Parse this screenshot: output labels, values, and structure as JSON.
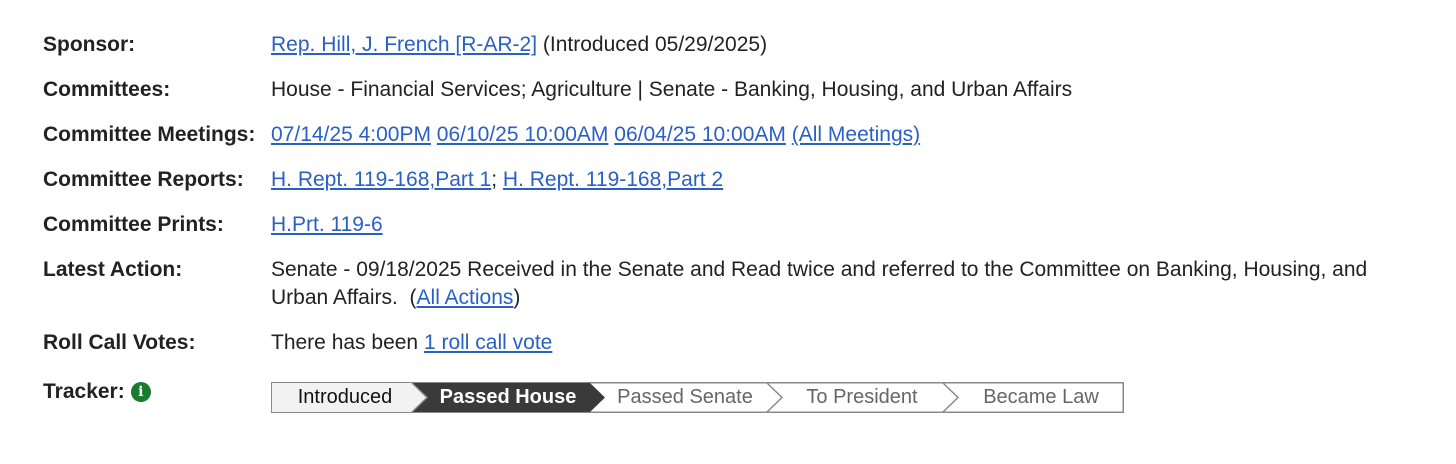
{
  "sponsor": {
    "label": "Sponsor:",
    "link": "Rep. Hill, J. French [R-AR-2]",
    "introduced": "(Introduced 05/29/2025)"
  },
  "committees": {
    "label": "Committees:",
    "text": "House - Financial Services; Agriculture | Senate - Banking, Housing, and Urban Affairs"
  },
  "meetings": {
    "label": "Committee Meetings:",
    "items": [
      "07/14/25 4:00PM",
      "06/10/25 10:00AM",
      "06/04/25 10:00AM"
    ],
    "all": "(All Meetings)"
  },
  "reports": {
    "label": "Committee Reports:",
    "items": [
      "H. Rept. 119-168,Part 1",
      "H. Rept. 119-168,Part 2"
    ],
    "separator": ";"
  },
  "prints": {
    "label": "Committee Prints:",
    "link": "H.Prt. 119-6"
  },
  "latest_action": {
    "label": "Latest Action:",
    "text": "Senate - 09/18/2025 Received in the Senate and Read twice and referred to the Committee on Banking, Housing, and Urban Affairs.",
    "open_paren": "(",
    "link": "All Actions",
    "close_paren": ")"
  },
  "roll_call": {
    "label": "Roll Call Votes:",
    "prefix": "There has been",
    "link": "1 roll call vote"
  },
  "tracker": {
    "label": "Tracker:",
    "info_icon": "info-icon",
    "steps": [
      "Introduced",
      "Passed House",
      "Passed Senate",
      "To President",
      "Became Law"
    ],
    "current_index": 1
  },
  "colors": {
    "link": "#2a60c4",
    "completed_step": "#f2f2f2",
    "current_step": "#3a3a3a",
    "info_icon": "#1a7a2e"
  }
}
